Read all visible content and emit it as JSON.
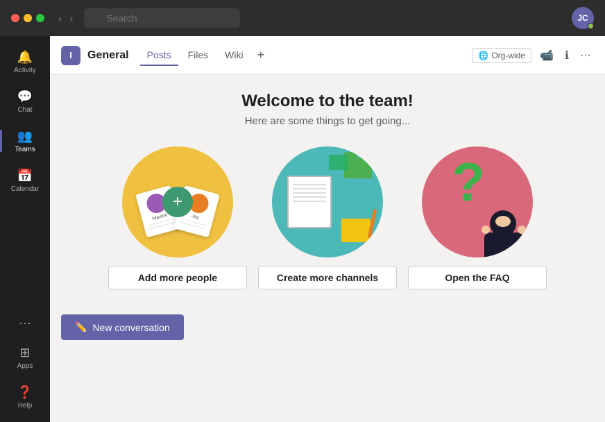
{
  "titleBar": {
    "searchPlaceholder": "Search",
    "avatarInitials": "JC",
    "backArrow": "‹",
    "forwardArrow": "›"
  },
  "sidebar": {
    "items": [
      {
        "id": "activity",
        "label": "Activity",
        "icon": "🔔",
        "active": false
      },
      {
        "id": "chat",
        "label": "Chat",
        "icon": "💬",
        "active": false
      },
      {
        "id": "teams",
        "label": "Teams",
        "icon": "👥",
        "active": true
      },
      {
        "id": "calendar",
        "label": "Calendar",
        "icon": "📅",
        "active": false
      }
    ],
    "moreLabel": "···",
    "appsLabel": "Apps",
    "helpLabel": "Help"
  },
  "channel": {
    "iconLabel": "I",
    "name": "General",
    "tabs": [
      {
        "id": "posts",
        "label": "Posts",
        "active": true
      },
      {
        "id": "files",
        "label": "Files",
        "active": false
      },
      {
        "id": "wiki",
        "label": "Wiki",
        "active": false
      }
    ],
    "addTabLabel": "+",
    "orgWideBadge": "Org-wide",
    "videoIcon": "📹",
    "infoIcon": "ℹ",
    "moreIcon": "···"
  },
  "welcome": {
    "title": "Welcome to the team!",
    "subtitle": "Here are some things to get going...",
    "cards": [
      {
        "id": "add-people",
        "buttonLabel": "Add more people"
      },
      {
        "id": "create-channels",
        "buttonLabel": "Create more channels"
      },
      {
        "id": "faq",
        "buttonLabel": "Open the FAQ"
      }
    ],
    "newConversationLabel": "New conversation"
  },
  "colors": {
    "accent": "#6264a7",
    "cardYellow": "#f0c040",
    "cardTeal": "#4db8b8",
    "cardPink": "#d9697a"
  }
}
